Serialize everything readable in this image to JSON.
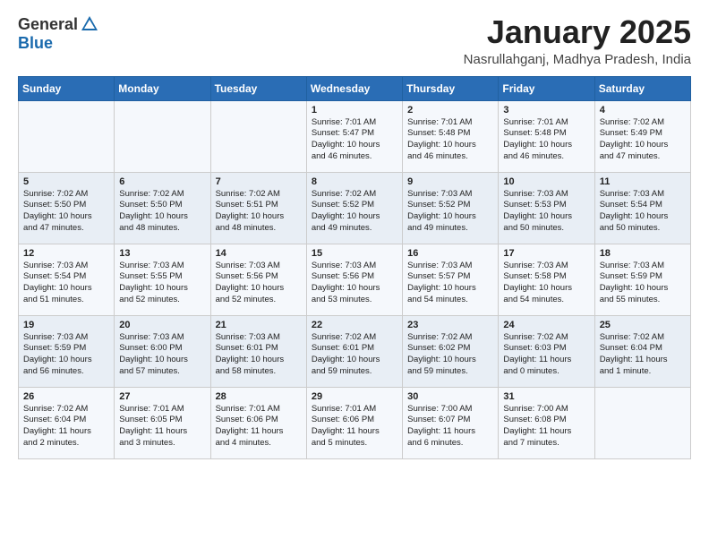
{
  "header": {
    "logo_general": "General",
    "logo_blue": "Blue",
    "title": "January 2025",
    "location": "Nasrullahganj, Madhya Pradesh, India"
  },
  "weekdays": [
    "Sunday",
    "Monday",
    "Tuesday",
    "Wednesday",
    "Thursday",
    "Friday",
    "Saturday"
  ],
  "weeks": [
    [
      {
        "day": "",
        "info": ""
      },
      {
        "day": "",
        "info": ""
      },
      {
        "day": "",
        "info": ""
      },
      {
        "day": "1",
        "info": "Sunrise: 7:01 AM\nSunset: 5:47 PM\nDaylight: 10 hours\nand 46 minutes."
      },
      {
        "day": "2",
        "info": "Sunrise: 7:01 AM\nSunset: 5:48 PM\nDaylight: 10 hours\nand 46 minutes."
      },
      {
        "day": "3",
        "info": "Sunrise: 7:01 AM\nSunset: 5:48 PM\nDaylight: 10 hours\nand 46 minutes."
      },
      {
        "day": "4",
        "info": "Sunrise: 7:02 AM\nSunset: 5:49 PM\nDaylight: 10 hours\nand 47 minutes."
      }
    ],
    [
      {
        "day": "5",
        "info": "Sunrise: 7:02 AM\nSunset: 5:50 PM\nDaylight: 10 hours\nand 47 minutes."
      },
      {
        "day": "6",
        "info": "Sunrise: 7:02 AM\nSunset: 5:50 PM\nDaylight: 10 hours\nand 48 minutes."
      },
      {
        "day": "7",
        "info": "Sunrise: 7:02 AM\nSunset: 5:51 PM\nDaylight: 10 hours\nand 48 minutes."
      },
      {
        "day": "8",
        "info": "Sunrise: 7:02 AM\nSunset: 5:52 PM\nDaylight: 10 hours\nand 49 minutes."
      },
      {
        "day": "9",
        "info": "Sunrise: 7:03 AM\nSunset: 5:52 PM\nDaylight: 10 hours\nand 49 minutes."
      },
      {
        "day": "10",
        "info": "Sunrise: 7:03 AM\nSunset: 5:53 PM\nDaylight: 10 hours\nand 50 minutes."
      },
      {
        "day": "11",
        "info": "Sunrise: 7:03 AM\nSunset: 5:54 PM\nDaylight: 10 hours\nand 50 minutes."
      }
    ],
    [
      {
        "day": "12",
        "info": "Sunrise: 7:03 AM\nSunset: 5:54 PM\nDaylight: 10 hours\nand 51 minutes."
      },
      {
        "day": "13",
        "info": "Sunrise: 7:03 AM\nSunset: 5:55 PM\nDaylight: 10 hours\nand 52 minutes."
      },
      {
        "day": "14",
        "info": "Sunrise: 7:03 AM\nSunset: 5:56 PM\nDaylight: 10 hours\nand 52 minutes."
      },
      {
        "day": "15",
        "info": "Sunrise: 7:03 AM\nSunset: 5:56 PM\nDaylight: 10 hours\nand 53 minutes."
      },
      {
        "day": "16",
        "info": "Sunrise: 7:03 AM\nSunset: 5:57 PM\nDaylight: 10 hours\nand 54 minutes."
      },
      {
        "day": "17",
        "info": "Sunrise: 7:03 AM\nSunset: 5:58 PM\nDaylight: 10 hours\nand 54 minutes."
      },
      {
        "day": "18",
        "info": "Sunrise: 7:03 AM\nSunset: 5:59 PM\nDaylight: 10 hours\nand 55 minutes."
      }
    ],
    [
      {
        "day": "19",
        "info": "Sunrise: 7:03 AM\nSunset: 5:59 PM\nDaylight: 10 hours\nand 56 minutes."
      },
      {
        "day": "20",
        "info": "Sunrise: 7:03 AM\nSunset: 6:00 PM\nDaylight: 10 hours\nand 57 minutes."
      },
      {
        "day": "21",
        "info": "Sunrise: 7:03 AM\nSunset: 6:01 PM\nDaylight: 10 hours\nand 58 minutes."
      },
      {
        "day": "22",
        "info": "Sunrise: 7:02 AM\nSunset: 6:01 PM\nDaylight: 10 hours\nand 59 minutes."
      },
      {
        "day": "23",
        "info": "Sunrise: 7:02 AM\nSunset: 6:02 PM\nDaylight: 10 hours\nand 59 minutes."
      },
      {
        "day": "24",
        "info": "Sunrise: 7:02 AM\nSunset: 6:03 PM\nDaylight: 11 hours\nand 0 minutes."
      },
      {
        "day": "25",
        "info": "Sunrise: 7:02 AM\nSunset: 6:04 PM\nDaylight: 11 hours\nand 1 minute."
      }
    ],
    [
      {
        "day": "26",
        "info": "Sunrise: 7:02 AM\nSunset: 6:04 PM\nDaylight: 11 hours\nand 2 minutes."
      },
      {
        "day": "27",
        "info": "Sunrise: 7:01 AM\nSunset: 6:05 PM\nDaylight: 11 hours\nand 3 minutes."
      },
      {
        "day": "28",
        "info": "Sunrise: 7:01 AM\nSunset: 6:06 PM\nDaylight: 11 hours\nand 4 minutes."
      },
      {
        "day": "29",
        "info": "Sunrise: 7:01 AM\nSunset: 6:06 PM\nDaylight: 11 hours\nand 5 minutes."
      },
      {
        "day": "30",
        "info": "Sunrise: 7:00 AM\nSunset: 6:07 PM\nDaylight: 11 hours\nand 6 minutes."
      },
      {
        "day": "31",
        "info": "Sunrise: 7:00 AM\nSunset: 6:08 PM\nDaylight: 11 hours\nand 7 minutes."
      },
      {
        "day": "",
        "info": ""
      }
    ]
  ]
}
